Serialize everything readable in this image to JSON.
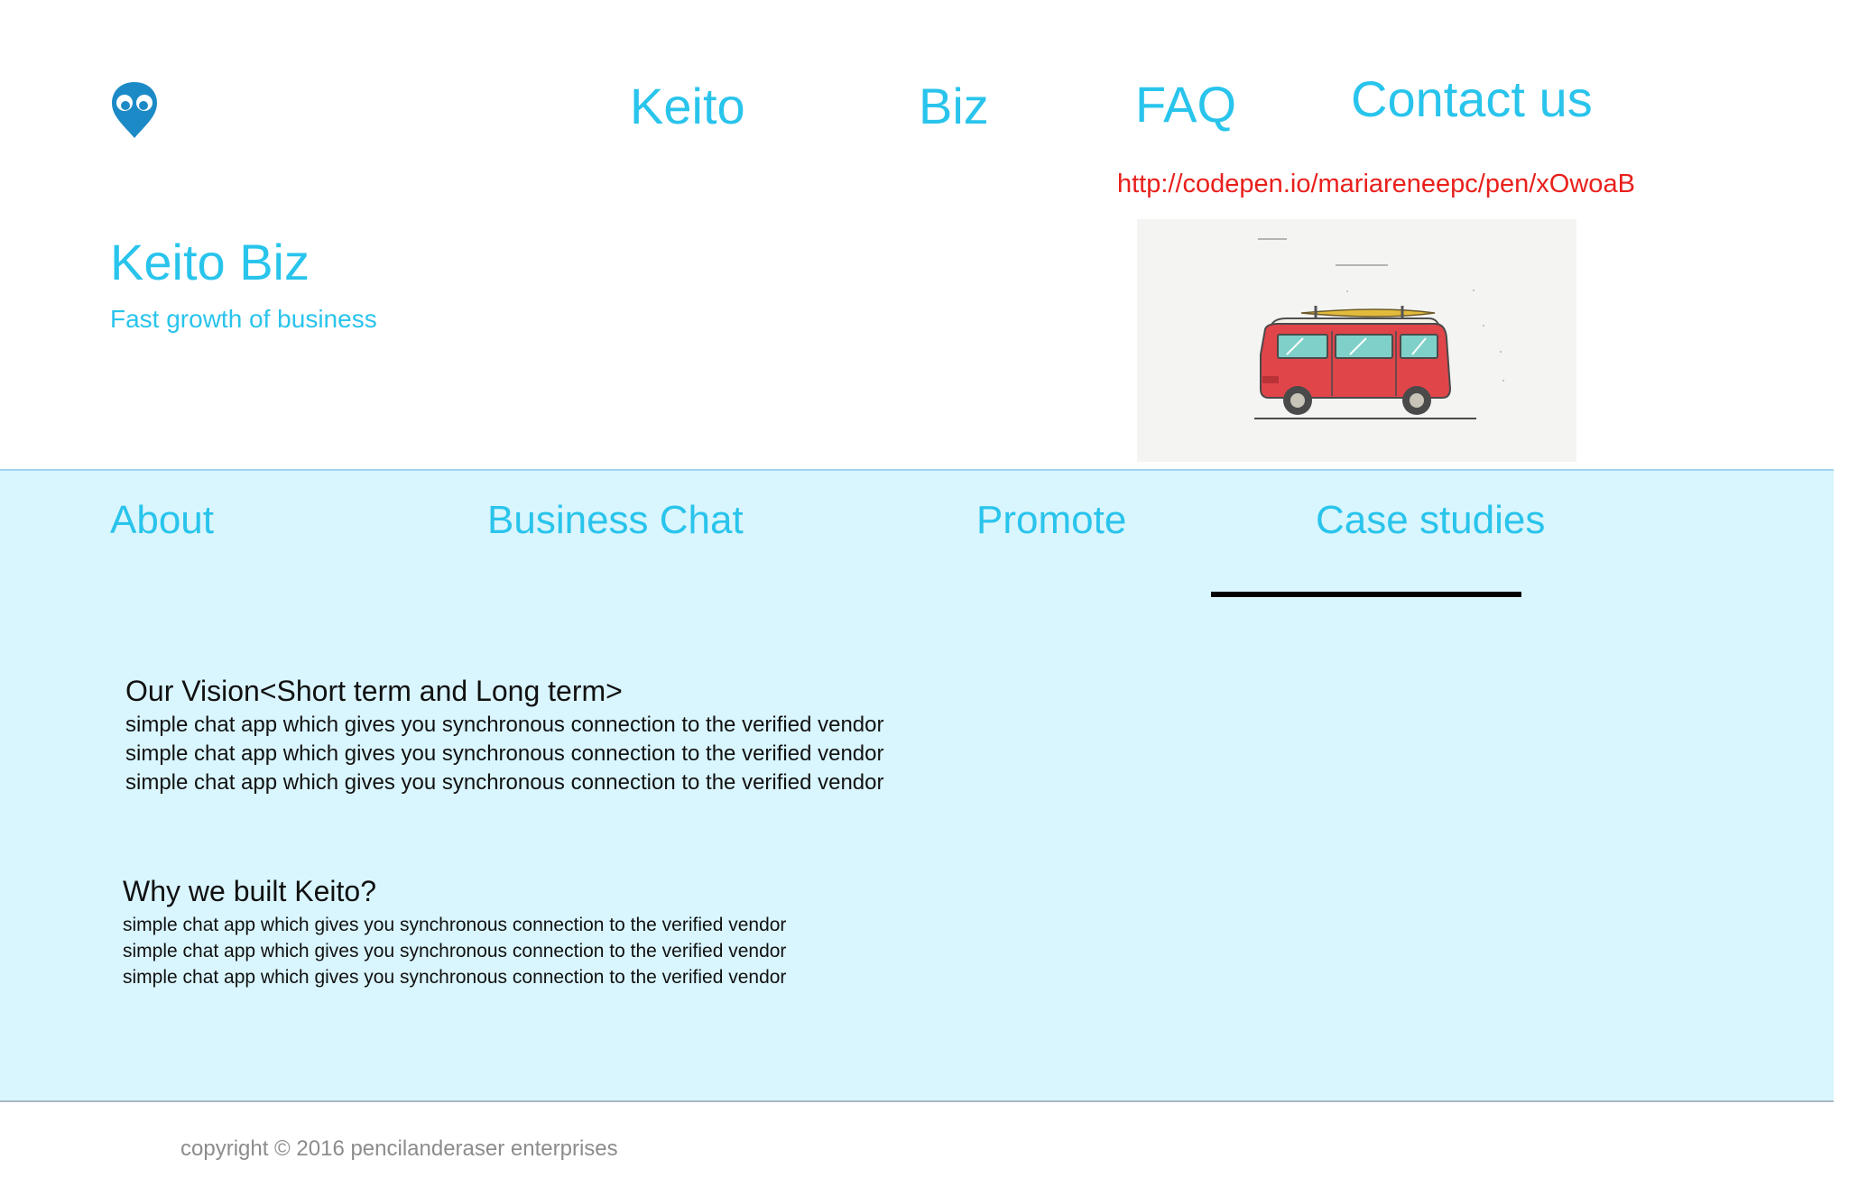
{
  "header": {
    "logo_icon": "map-pin-eyes-icon",
    "nav": {
      "keito": "Keito",
      "biz": "Biz",
      "faq": "FAQ",
      "contact": "Contact us"
    },
    "url": "http://codepen.io/mariareneepc/pen/xOwoaB"
  },
  "hero": {
    "title": "Keito Biz",
    "subtitle": "Fast growth of business",
    "image": "red-camper-van-illustration"
  },
  "tabs": {
    "about": "About",
    "business_chat": "Business Chat",
    "promote": "Promote",
    "case_studies": "Case studies",
    "active": "Case studies"
  },
  "vision": {
    "heading": "Our Vision<Short term and Long term>",
    "lines": [
      "simple chat app which gives you synchronous connection to the verified vendor",
      "simple chat app which gives you synchronous connection to the verified vendor",
      "simple chat app which gives you synchronous connection to the verified vendor"
    ]
  },
  "why": {
    "heading": "Why we built Keito?",
    "lines": [
      "simple chat app which gives you synchronous connection to the verified vendor",
      "simple chat app which gives you synchronous connection to the verified vendor",
      "simple chat app which gives you synchronous connection to the verified vendor"
    ]
  },
  "footer": {
    "copyright": "copyright © 2016 pencilanderaser enterprises"
  },
  "colors": {
    "accent": "#29c4ec",
    "panel_background": "#d9f5fd",
    "link_red": "#e8201c",
    "logo_blue": "#1c8ac6"
  }
}
